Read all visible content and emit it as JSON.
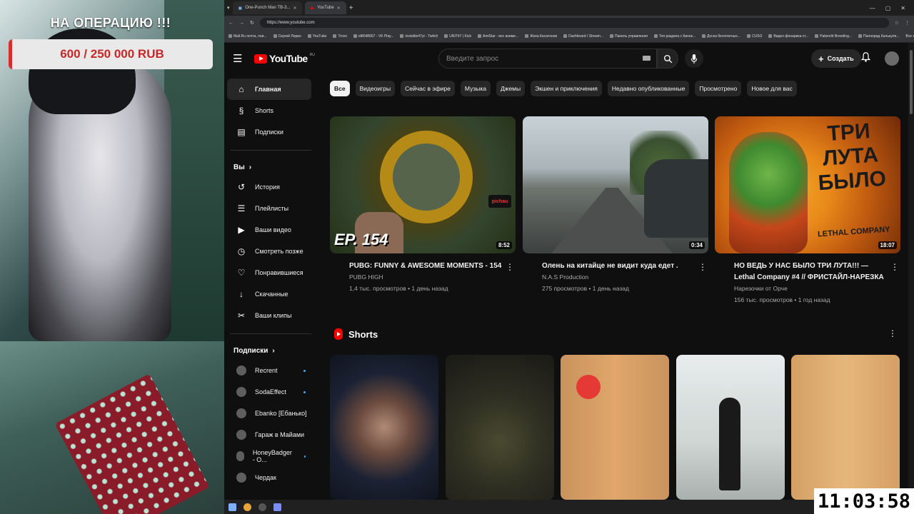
{
  "stream": {
    "donation_title": "НА ОПЕРАЦИЮ !!!",
    "donation_amount": "600 / 250 000 RUB",
    "donation_progress_fraction": 0.0024,
    "clock": "11:03:58",
    "accent_color": "#d32f2f"
  },
  "browser": {
    "tabs": [
      {
        "label": "One-Punch Man TB-3...",
        "icon": "tv-icon"
      },
      {
        "label": "YouTube",
        "icon": "youtube-icon",
        "active": true
      }
    ],
    "url": "https://www.youtube.com",
    "bookmarks": [
      "Mail.Ru почта, пои...",
      "Сергей Лерин",
      "YouTube",
      "Trovo",
      "id8048667 - VK Play...",
      "invisible47yt - Twitch",
      "UNIT47 | Kick",
      "AmiStar - все аниме...",
      "Жека Касатонов",
      "Dashboard / Stream...",
      "Панель управления",
      "Топ раздача с Кинок...",
      "Доска бесплатных...",
      "CUSO",
      "Видео фонарика ст...",
      "Palworld Breeding...",
      "Палнорад Калькуля..."
    ],
    "bookmarks_all": "Все закладки"
  },
  "youtube": {
    "logo_text": "YouTube",
    "logo_region": "RU",
    "search_placeholder": "Введите запрос",
    "create_label": "Создать",
    "sidebar": {
      "main": [
        {
          "label": "Главная",
          "icon": "home-icon",
          "active": true
        },
        {
          "label": "Shorts",
          "icon": "shorts-icon"
        },
        {
          "label": "Подписки",
          "icon": "subscriptions-icon"
        }
      ],
      "you_header": "Вы",
      "you": [
        {
          "label": "История",
          "icon": "history-icon"
        },
        {
          "label": "Плейлисты",
          "icon": "playlists-icon"
        },
        {
          "label": "Ваши видео",
          "icon": "your-videos-icon"
        },
        {
          "label": "Смотреть позже",
          "icon": "watch-later-icon"
        },
        {
          "label": "Понравившиеся",
          "icon": "like-icon"
        },
        {
          "label": "Скачанные",
          "icon": "download-icon"
        },
        {
          "label": "Ваши клипы",
          "icon": "clips-icon"
        }
      ],
      "subs_header": "Подписки",
      "subscriptions": [
        {
          "label": "Recrent",
          "new": true
        },
        {
          "label": "SodaEffect",
          "new": true
        },
        {
          "label": "Ebanko [Ебанько]",
          "new": false
        },
        {
          "label": "Гараж в Майами",
          "new": false
        },
        {
          "label": "HoneyBadger - O...",
          "new": true
        },
        {
          "label": "Чердак",
          "new": false
        }
      ]
    },
    "chips": [
      "Все",
      "Видеоигры",
      "Сейчас в эфире",
      "Музыка",
      "Джемы",
      "Экшен и приключения",
      "Недавно опубликованные",
      "Просмотрено",
      "Новое для вас"
    ],
    "videos": [
      {
        "title": "PUBG: FUNNY & AWESOME MOMENTS - 154",
        "channel": "PUBG HIGH",
        "stats": "1,4 тыс. просмотров • 1 день назад",
        "duration": "8:52",
        "overlay": "EP. 154",
        "badge": "pichau"
      },
      {
        "title": "Олень на китайце не видит куда едет .",
        "channel": "N.A.S Production",
        "stats": "275 просмотров • 1 день назад",
        "duration": "0:34"
      },
      {
        "title": "НО ВЕДЬ У НАС БЫЛО ТРИ ЛУТА!!! — Lethal Company #4 // ФРИСТАЙЛ-НАРЕЗКА",
        "channel": "Нарезочки от Орче",
        "stats": "156 тыс. просмотров • 1 год назад",
        "duration": "18:07",
        "overlay": "ТРИ ЛУТА БЫЛО",
        "overlay2": "LETHAL COMPANY"
      }
    ],
    "shorts_title": "Shorts"
  }
}
